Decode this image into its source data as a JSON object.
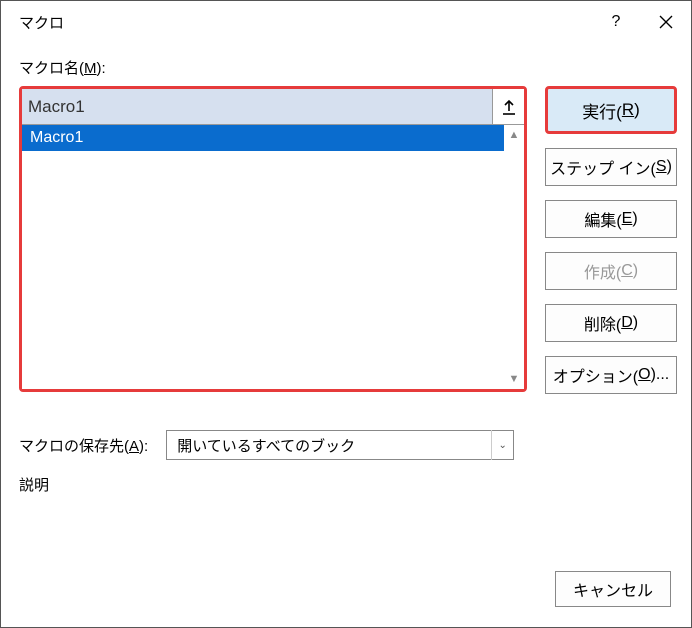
{
  "title": "マクロ",
  "labels": {
    "macro_name_pre": "マクロ名(",
    "macro_name_u": "M",
    "macro_name_post": "):",
    "store_pre": "マクロの保存先(",
    "store_u": "A",
    "store_post": "):",
    "desc": "説明"
  },
  "input": {
    "value": "Macro1"
  },
  "list": {
    "items": [
      "Macro1"
    ]
  },
  "store": {
    "selected": "開いているすべてのブック"
  },
  "buttons": {
    "run_pre": "実行(",
    "run_u": "R",
    "run_post": ")",
    "step_pre": "ステップ イン(",
    "step_u": "S",
    "step_post": ")",
    "edit_pre": "編集(",
    "edit_u": "E",
    "edit_post": ")",
    "create_pre": "作成(",
    "create_u": "C",
    "create_post": ")",
    "delete_pre": "削除(",
    "delete_u": "D",
    "delete_post": ")",
    "options_pre": "オプション(",
    "options_u": "O",
    "options_post": ")...",
    "cancel": "キャンセル"
  }
}
